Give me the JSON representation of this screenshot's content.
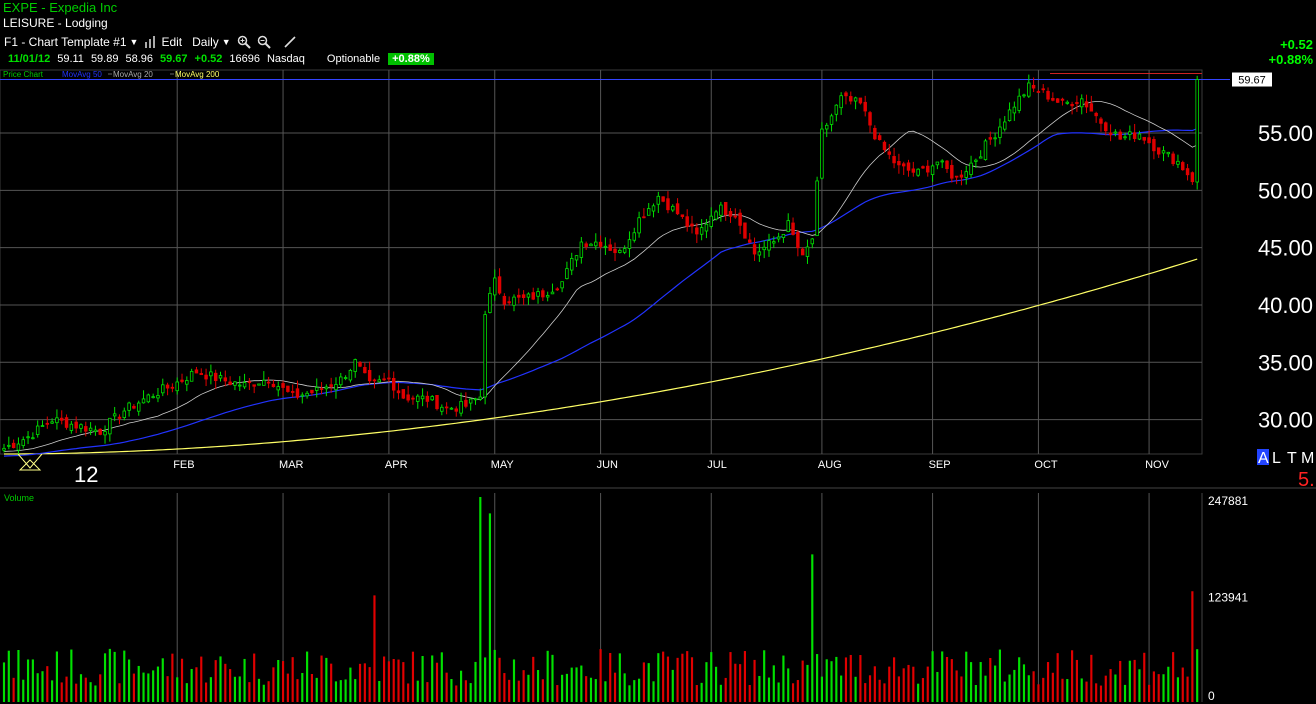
{
  "header": {
    "title": "EXPE - Expedia Inc",
    "sector": "LEISURE - Lodging"
  },
  "toolbar": {
    "template": "F1 - Chart Template #1",
    "edit": "Edit",
    "period": "Daily"
  },
  "quote": {
    "date": "11/01/12",
    "open": "59.11",
    "high": "59.89",
    "low": "58.96",
    "close": "59.67",
    "change": "+0.52",
    "volume": "16696",
    "exchange": "Nasdaq",
    "optionable": "Optionable",
    "change_pct_badge": "+0.88%",
    "change_right": "+0.52",
    "change_pct_right": "+0.88%"
  },
  "colors": {
    "up": "#00e000",
    "down": "#e00000",
    "ma200": "#ffff66",
    "ma50": "#2233ff",
    "ma20": "#cccccc",
    "grid": "#555555",
    "price_line": "#3344ff"
  },
  "price_panel": {
    "legend_price": "Price Chart",
    "legend_ma50": "MovAvg 50",
    "legend_ma20": "MovAvg 20",
    "legend_ma200": "MovAvg 200",
    "last_price": "59.67",
    "y_labels": [
      "55.00",
      "50.00",
      "45.00",
      "40.00",
      "35.00",
      "30.00"
    ],
    "month_labels": [
      "12",
      "FEB",
      "MAR",
      "APR",
      "MAY",
      "JUN",
      "JUL",
      "AUG",
      "SEP",
      "OCT",
      "NOV"
    ],
    "right_tags": [
      "A",
      "L",
      "T",
      "M",
      "5."
    ]
  },
  "volume_panel": {
    "label": "Volume",
    "y_labels": [
      "247881",
      "123941",
      "0"
    ]
  },
  "chart_data": {
    "type": "candlestick",
    "ylim": [
      27,
      60.5
    ],
    "y_ticks": [
      30,
      35,
      40,
      45,
      50,
      55
    ],
    "volume_max": 247881,
    "anchors_close": [
      [
        0,
        27.5
      ],
      [
        5,
        28.5
      ],
      [
        10,
        30.0
      ],
      [
        15,
        29.5
      ],
      [
        20,
        29.0
      ],
      [
        25,
        30.8
      ],
      [
        30,
        32.0
      ],
      [
        35,
        33.0
      ],
      [
        40,
        34.2
      ],
      [
        45,
        33.5
      ],
      [
        50,
        33.0
      ],
      [
        55,
        33.6
      ],
      [
        60,
        32.0
      ],
      [
        65,
        32.5
      ],
      [
        70,
        33.5
      ],
      [
        73,
        35.0
      ],
      [
        76,
        33.0
      ],
      [
        80,
        33.5
      ],
      [
        83,
        32.0
      ],
      [
        88,
        31.8
      ],
      [
        92,
        31.0
      ],
      [
        96,
        31.2
      ],
      [
        99,
        32.0
      ],
      [
        100,
        39.5
      ],
      [
        102,
        42.0
      ],
      [
        104,
        40.5
      ],
      [
        108,
        40.5
      ],
      [
        112,
        41.0
      ],
      [
        116,
        42.0
      ],
      [
        120,
        45.5
      ],
      [
        124,
        45.5
      ],
      [
        128,
        44.5
      ],
      [
        132,
        47.5
      ],
      [
        136,
        49.5
      ],
      [
        140,
        48.0
      ],
      [
        144,
        46.0
      ],
      [
        148,
        48.5
      ],
      [
        152,
        48.0
      ],
      [
        156,
        44.5
      ],
      [
        160,
        45.5
      ],
      [
        163,
        47.0
      ],
      [
        166,
        44.0
      ],
      [
        168,
        45.8
      ],
      [
        170,
        55.0
      ],
      [
        174,
        58.0
      ],
      [
        178,
        57.5
      ],
      [
        182,
        54.0
      ],
      [
        186,
        52.0
      ],
      [
        190,
        51.5
      ],
      [
        194,
        52.5
      ],
      [
        198,
        51.0
      ],
      [
        202,
        52.8
      ],
      [
        206,
        55.0
      ],
      [
        210,
        57.5
      ],
      [
        213,
        59.0
      ],
      [
        216,
        58.5
      ],
      [
        220,
        57.5
      ],
      [
        224,
        58.0
      ],
      [
        228,
        56.0
      ],
      [
        232,
        54.5
      ],
      [
        236,
        55.0
      ],
      [
        240,
        53.5
      ],
      [
        244,
        52.5
      ],
      [
        247,
        51.0
      ],
      [
        248,
        59.67
      ]
    ],
    "volume_spikes": [
      [
        77,
        0.52
      ],
      [
        99,
        1.0
      ],
      [
        101,
        0.92
      ],
      [
        168,
        0.72
      ],
      [
        237,
        0.24
      ],
      [
        247,
        0.54
      ]
    ]
  }
}
